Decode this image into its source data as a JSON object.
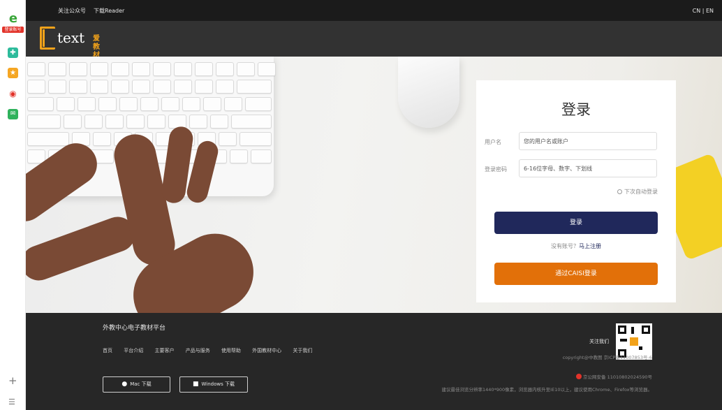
{
  "browser_sidebar": {
    "icons": [
      "ie-logo-icon",
      "login-badge",
      "app-plus-icon",
      "star-icon",
      "weibo-icon",
      "mail-icon",
      "add-icon",
      "menu-icon"
    ],
    "badge_label": "登录账号",
    "colors": {
      "login_badge": "#e2332a",
      "ie_green": "#3aa63a"
    }
  },
  "topbar": {
    "follow_label": "关注公众号",
    "download_label": "下载Reader",
    "lang_label": "CN | EN"
  },
  "header": {
    "logo_word": "text",
    "logo_sub": "爱教材"
  },
  "login": {
    "title": "登录",
    "username_label": "用户名",
    "username_placeholder": "您的用户名或账户",
    "password_label": "登录密码",
    "password_placeholder": "6-16位字母、数字、下划线",
    "remember_label": "下次自动登录",
    "submit_label": "登录",
    "no_account_text": "没有账号？",
    "register_link": "马上注册",
    "caisi_label": "通过CAISI登录",
    "colors": {
      "primary": "#20285b",
      "secondary": "#e27009"
    }
  },
  "footer": {
    "platform_title": "外教中心电子教材平台",
    "nav": [
      "首页",
      "平台介绍",
      "主要客户",
      "产品与服务",
      "使用帮助",
      "外国教材中心",
      "关于我们"
    ],
    "mac_download": "Mac 下载",
    "windows_download": "Windows 下载",
    "follow_us": "关注我们",
    "copyright": "copyright@中教图 京ICP备11007853号-6",
    "police_record": "京公网安备 11010802024590号",
    "browser_tip": "建议最佳浏览分辨率1440*900像素，浏览器内核升至IE10以上，建议使用Chrome、Firefox等浏览器。"
  }
}
